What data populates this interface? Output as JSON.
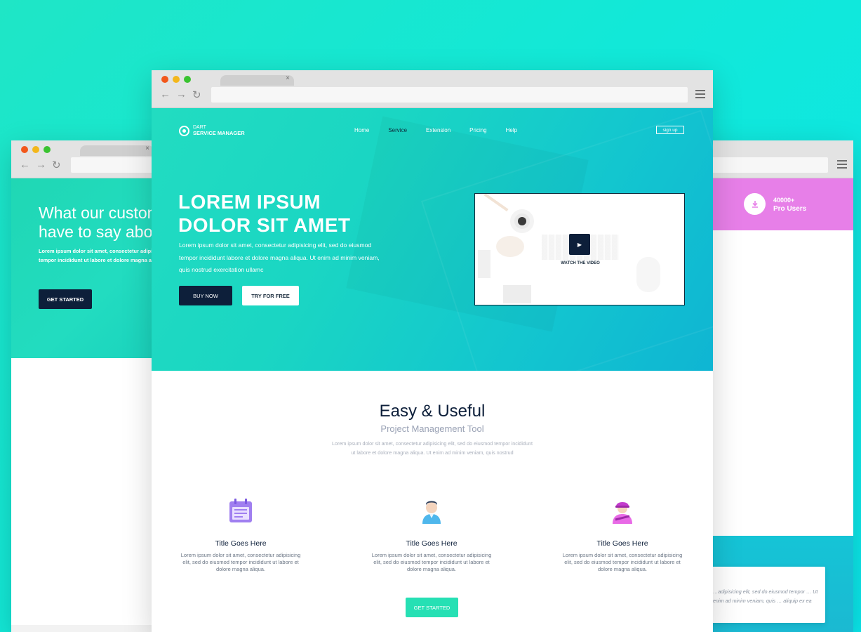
{
  "left_window": {
    "hero_heading_line1": "What our customers",
    "hero_heading_line2": "have to say about",
    "hero_text_line1": "Lorem ipsum dolor sit amet, consectetur adipisicing elit,",
    "hero_text_line2": "tempor incididunt ut labore et dolore magna aliqua.",
    "button_label": "GET STARTED"
  },
  "right_window": {
    "promo_icon": "download-icon",
    "promo_count": "40000+",
    "promo_label": "Pro Users",
    "quote_text": "…adipisicing elit, sed do eiusmod tempor … Ut enim ad minim veniam, quis … aliquip ex ea"
  },
  "main_window": {
    "logo": {
      "top": "DART",
      "bottom": "SERVICE MANAGER"
    },
    "nav": [
      {
        "label": "Home",
        "active": false
      },
      {
        "label": "Service",
        "active": true
      },
      {
        "label": "Extension",
        "active": false
      },
      {
        "label": "Pricing",
        "active": false
      },
      {
        "label": "Help",
        "active": false
      }
    ],
    "signup_label": "sign up",
    "hero": {
      "title_line1": "LOREM IPSUM",
      "title_line2": "DOLOR SIT AMET",
      "description": "Lorem ipsum dolor sit amet, consectetur adipisicing elit, sed do eiusmod tempor incididunt labore et dolore magna aliqua. Ut enim ad minim veniam, quis nostrud exercitation ullamc",
      "buy_label": "BUY NOW",
      "try_label": "TRY FOR FREE",
      "video_label": "WATCH THE VIDEO"
    },
    "section": {
      "title": "Easy & Useful",
      "subtitle": "Project Management Tool",
      "description": "Lorem ipsum dolor sit amet, consectetur adipisicing elit, sed do eiusmod tempor incididunt ut labore et dolore magna aliqua. Ut enim ad minim veniam, quis nostrud"
    },
    "features": [
      {
        "icon": "calendar-icon",
        "title": "Title Goes Here",
        "description": "Lorem ipsum dolor sit amet, consectetur adipisicing elit, sed do eiusmod tempor incididunt ut labore et dolore magna aliqua."
      },
      {
        "icon": "user-icon",
        "title": "Title Goes Here",
        "description": "Lorem ipsum dolor sit amet, consectetur adipisicing elit, sed do eiusmod tempor incididunt ut labore et dolore magna aliqua."
      },
      {
        "icon": "worker-icon",
        "title": "Title Goes Here",
        "description": "Lorem ipsum dolor sit amet, consectetur adipisicing elit, sed do eiusmod tempor incididunt ut labore et dolore magna aliqua."
      }
    ],
    "cta_label": "GET STARTED"
  },
  "colors": {
    "background": "#12e8d8",
    "navy": "#0d1f3a",
    "teal": "#1ad6c3",
    "pink": "#e77fe8",
    "purple": "#a07ff0",
    "cta": "#26e0b4"
  }
}
